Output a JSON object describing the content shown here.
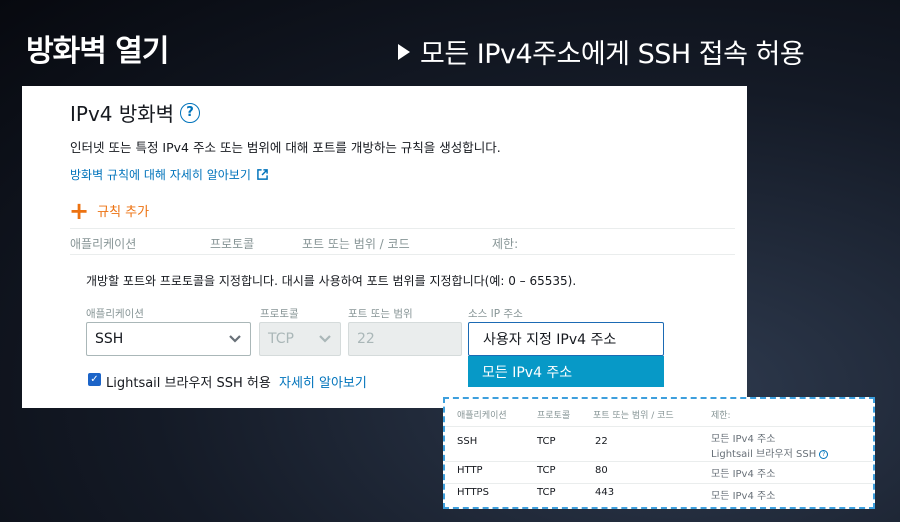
{
  "slide": {
    "title": "방화벽 열기",
    "subtitle": "모든 IPv4주소에게 SSH 접속 허용"
  },
  "panel": {
    "title": "IPv4 방화벽",
    "help": "?",
    "description": "인터넷 또는 특정 IPv4 주소 또는 범위에 대해 포트를 개방하는 규칙을 생성합니다.",
    "learn_more": "방화벽 규칙에 대해 자세히 알아보기",
    "add_rule": "규칙 추가",
    "columns": [
      "애플리케이션",
      "프로토콜",
      "포트 또는 범위 / 코드",
      "제한:"
    ],
    "edit_note": "개방할 포트와 프로토콜을 지정합니다. 대시를 사용하여 포트 범위를 지정합니다(예: 0 – 65535).",
    "fields": {
      "application": {
        "label": "애플리케이션",
        "value": "SSH"
      },
      "protocol": {
        "label": "프로토콜",
        "value": "TCP"
      },
      "port": {
        "label": "포트 또는 범위",
        "value": "22"
      },
      "source": {
        "label": "소스 IP 주소",
        "value": "사용자 지정 IPv4 주소",
        "option": "모든 IPv4 주소"
      }
    },
    "lightsail_checkbox": {
      "label": "Lightsail 브라우저 SSH 허용",
      "link": "자세히 알아보기"
    }
  },
  "rules_table": {
    "columns": [
      "애플리케이션",
      "프로토콜",
      "포트 또는 범위 / 코드",
      "제한:"
    ],
    "rows": [
      {
        "app": "SSH",
        "protocol": "TCP",
        "port": "22",
        "restriction": "모든 IPv4 주소",
        "note": "Lightsail 브라우저 SSH"
      },
      {
        "app": "HTTP",
        "protocol": "TCP",
        "port": "80",
        "restriction": "모든 IPv4 주소"
      },
      {
        "app": "HTTPS",
        "protocol": "TCP",
        "port": "443",
        "restriction": "모든 IPv4 주소"
      }
    ]
  },
  "colors": {
    "accent_orange": "#ec7211",
    "link_blue": "#0073bb",
    "selected_option": "#0799c7"
  }
}
